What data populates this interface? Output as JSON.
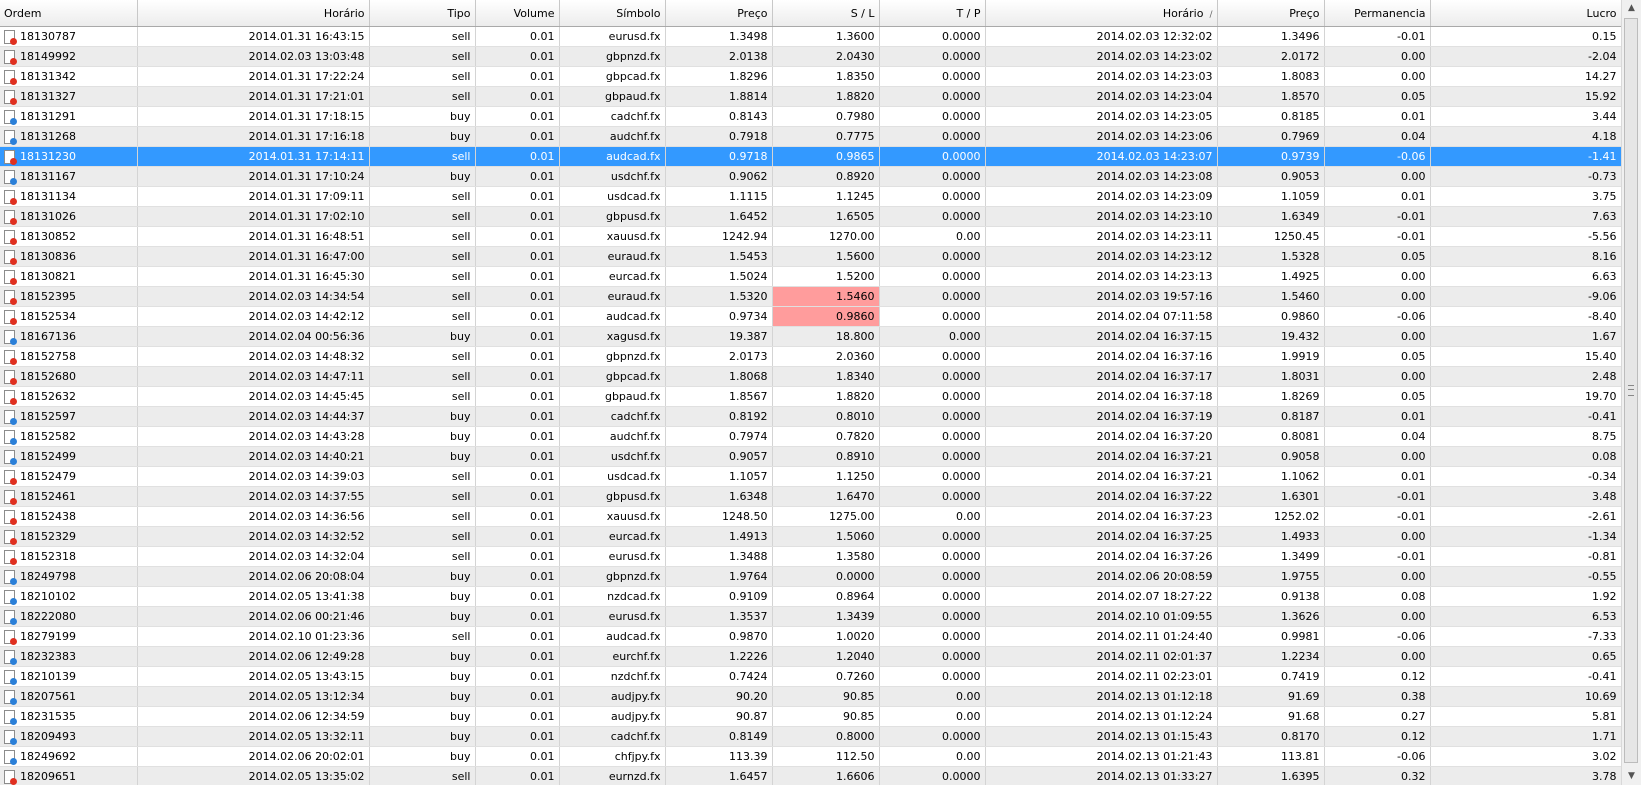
{
  "columns": [
    {
      "key": "ordem",
      "label": "Ordem"
    },
    {
      "key": "horario_open",
      "label": "Horário"
    },
    {
      "key": "tipo",
      "label": "Tipo"
    },
    {
      "key": "volume",
      "label": "Volume"
    },
    {
      "key": "simbolo",
      "label": "Símbolo"
    },
    {
      "key": "preco_open",
      "label": "Preço"
    },
    {
      "key": "sl",
      "label": "S / L"
    },
    {
      "key": "tp",
      "label": "T / P"
    },
    {
      "key": "horario_close",
      "label": "Horário",
      "sort_indicator": "/"
    },
    {
      "key": "preco_close",
      "label": "Preço"
    },
    {
      "key": "permanencia",
      "label": "Permanencia"
    },
    {
      "key": "lucro",
      "label": "Lucro"
    }
  ],
  "selected_row": 6,
  "highlighted_cells": [
    {
      "row": 13,
      "column": "sl"
    },
    {
      "row": 14,
      "column": "sl"
    }
  ],
  "colors": {
    "selection": "#3399ff",
    "highlight": "#ff9c9c",
    "sell_icon": "#e03020",
    "buy_icon": "#2a7fd8"
  },
  "rows": [
    [
      "18130787",
      "2014.01.31 16:43:15",
      "sell",
      "0.01",
      "eurusd.fx",
      "1.3498",
      "1.3600",
      "0.0000",
      "2014.02.03 12:32:02",
      "1.3496",
      "-0.01",
      "0.15"
    ],
    [
      "18149992",
      "2014.02.03 13:03:48",
      "sell",
      "0.01",
      "gbpnzd.fx",
      "2.0138",
      "2.0430",
      "0.0000",
      "2014.02.03 14:23:02",
      "2.0172",
      "0.00",
      "-2.04"
    ],
    [
      "18131342",
      "2014.01.31 17:22:24",
      "sell",
      "0.01",
      "gbpcad.fx",
      "1.8296",
      "1.8350",
      "0.0000",
      "2014.02.03 14:23:03",
      "1.8083",
      "0.00",
      "14.27"
    ],
    [
      "18131327",
      "2014.01.31 17:21:01",
      "sell",
      "0.01",
      "gbpaud.fx",
      "1.8814",
      "1.8820",
      "0.0000",
      "2014.02.03 14:23:04",
      "1.8570",
      "0.05",
      "15.92"
    ],
    [
      "18131291",
      "2014.01.31 17:18:15",
      "buy",
      "0.01",
      "cadchf.fx",
      "0.8143",
      "0.7980",
      "0.0000",
      "2014.02.03 14:23:05",
      "0.8185",
      "0.01",
      "3.44"
    ],
    [
      "18131268",
      "2014.01.31 17:16:18",
      "buy",
      "0.01",
      "audchf.fx",
      "0.7918",
      "0.7775",
      "0.0000",
      "2014.02.03 14:23:06",
      "0.7969",
      "0.04",
      "4.18"
    ],
    [
      "18131230",
      "2014.01.31 17:14:11",
      "sell",
      "0.01",
      "audcad.fx",
      "0.9718",
      "0.9865",
      "0.0000",
      "2014.02.03 14:23:07",
      "0.9739",
      "-0.06",
      "-1.41"
    ],
    [
      "18131167",
      "2014.01.31 17:10:24",
      "buy",
      "0.01",
      "usdchf.fx",
      "0.9062",
      "0.8920",
      "0.0000",
      "2014.02.03 14:23:08",
      "0.9053",
      "0.00",
      "-0.73"
    ],
    [
      "18131134",
      "2014.01.31 17:09:11",
      "sell",
      "0.01",
      "usdcad.fx",
      "1.1115",
      "1.1245",
      "0.0000",
      "2014.02.03 14:23:09",
      "1.1059",
      "0.01",
      "3.75"
    ],
    [
      "18131026",
      "2014.01.31 17:02:10",
      "sell",
      "0.01",
      "gbpusd.fx",
      "1.6452",
      "1.6505",
      "0.0000",
      "2014.02.03 14:23:10",
      "1.6349",
      "-0.01",
      "7.63"
    ],
    [
      "18130852",
      "2014.01.31 16:48:51",
      "sell",
      "0.01",
      "xauusd.fx",
      "1242.94",
      "1270.00",
      "0.00",
      "2014.02.03 14:23:11",
      "1250.45",
      "-0.01",
      "-5.56"
    ],
    [
      "18130836",
      "2014.01.31 16:47:00",
      "sell",
      "0.01",
      "euraud.fx",
      "1.5453",
      "1.5600",
      "0.0000",
      "2014.02.03 14:23:12",
      "1.5328",
      "0.05",
      "8.16"
    ],
    [
      "18130821",
      "2014.01.31 16:45:30",
      "sell",
      "0.01",
      "eurcad.fx",
      "1.5024",
      "1.5200",
      "0.0000",
      "2014.02.03 14:23:13",
      "1.4925",
      "0.00",
      "6.63"
    ],
    [
      "18152395",
      "2014.02.03 14:34:54",
      "sell",
      "0.01",
      "euraud.fx",
      "1.5320",
      "1.5460",
      "0.0000",
      "2014.02.03 19:57:16",
      "1.5460",
      "0.00",
      "-9.06"
    ],
    [
      "18152534",
      "2014.02.03 14:42:12",
      "sell",
      "0.01",
      "audcad.fx",
      "0.9734",
      "0.9860",
      "0.0000",
      "2014.02.04 07:11:58",
      "0.9860",
      "-0.06",
      "-8.40"
    ],
    [
      "18167136",
      "2014.02.04 00:56:36",
      "buy",
      "0.01",
      "xagusd.fx",
      "19.387",
      "18.800",
      "0.000",
      "2014.02.04 16:37:15",
      "19.432",
      "0.00",
      "1.67"
    ],
    [
      "18152758",
      "2014.02.03 14:48:32",
      "sell",
      "0.01",
      "gbpnzd.fx",
      "2.0173",
      "2.0360",
      "0.0000",
      "2014.02.04 16:37:16",
      "1.9919",
      "0.05",
      "15.40"
    ],
    [
      "18152680",
      "2014.02.03 14:47:11",
      "sell",
      "0.01",
      "gbpcad.fx",
      "1.8068",
      "1.8340",
      "0.0000",
      "2014.02.04 16:37:17",
      "1.8031",
      "0.00",
      "2.48"
    ],
    [
      "18152632",
      "2014.02.03 14:45:45",
      "sell",
      "0.01",
      "gbpaud.fx",
      "1.8567",
      "1.8820",
      "0.0000",
      "2014.02.04 16:37:18",
      "1.8269",
      "0.05",
      "19.70"
    ],
    [
      "18152597",
      "2014.02.03 14:44:37",
      "buy",
      "0.01",
      "cadchf.fx",
      "0.8192",
      "0.8010",
      "0.0000",
      "2014.02.04 16:37:19",
      "0.8187",
      "0.01",
      "-0.41"
    ],
    [
      "18152582",
      "2014.02.03 14:43:28",
      "buy",
      "0.01",
      "audchf.fx",
      "0.7974",
      "0.7820",
      "0.0000",
      "2014.02.04 16:37:20",
      "0.8081",
      "0.04",
      "8.75"
    ],
    [
      "18152499",
      "2014.02.03 14:40:21",
      "buy",
      "0.01",
      "usdchf.fx",
      "0.9057",
      "0.8910",
      "0.0000",
      "2014.02.04 16:37:21",
      "0.9058",
      "0.00",
      "0.08"
    ],
    [
      "18152479",
      "2014.02.03 14:39:03",
      "sell",
      "0.01",
      "usdcad.fx",
      "1.1057",
      "1.1250",
      "0.0000",
      "2014.02.04 16:37:21",
      "1.1062",
      "0.01",
      "-0.34"
    ],
    [
      "18152461",
      "2014.02.03 14:37:55",
      "sell",
      "0.01",
      "gbpusd.fx",
      "1.6348",
      "1.6470",
      "0.0000",
      "2014.02.04 16:37:22",
      "1.6301",
      "-0.01",
      "3.48"
    ],
    [
      "18152438",
      "2014.02.03 14:36:56",
      "sell",
      "0.01",
      "xauusd.fx",
      "1248.50",
      "1275.00",
      "0.00",
      "2014.02.04 16:37:23",
      "1252.02",
      "-0.01",
      "-2.61"
    ],
    [
      "18152329",
      "2014.02.03 14:32:52",
      "sell",
      "0.01",
      "eurcad.fx",
      "1.4913",
      "1.5060",
      "0.0000",
      "2014.02.04 16:37:25",
      "1.4933",
      "0.00",
      "-1.34"
    ],
    [
      "18152318",
      "2014.02.03 14:32:04",
      "sell",
      "0.01",
      "eurusd.fx",
      "1.3488",
      "1.3580",
      "0.0000",
      "2014.02.04 16:37:26",
      "1.3499",
      "-0.01",
      "-0.81"
    ],
    [
      "18249798",
      "2014.02.06 20:08:04",
      "buy",
      "0.01",
      "gbpnzd.fx",
      "1.9764",
      "0.0000",
      "0.0000",
      "2014.02.06 20:08:59",
      "1.9755",
      "0.00",
      "-0.55"
    ],
    [
      "18210102",
      "2014.02.05 13:41:38",
      "buy",
      "0.01",
      "nzdcad.fx",
      "0.9109",
      "0.8964",
      "0.0000",
      "2014.02.07 18:27:22",
      "0.9138",
      "0.08",
      "1.92"
    ],
    [
      "18222080",
      "2014.02.06 00:21:46",
      "buy",
      "0.01",
      "eurusd.fx",
      "1.3537",
      "1.3439",
      "0.0000",
      "2014.02.10 01:09:55",
      "1.3626",
      "0.00",
      "6.53"
    ],
    [
      "18279199",
      "2014.02.10 01:23:36",
      "sell",
      "0.01",
      "audcad.fx",
      "0.9870",
      "1.0020",
      "0.0000",
      "2014.02.11 01:24:40",
      "0.9981",
      "-0.06",
      "-7.33"
    ],
    [
      "18232383",
      "2014.02.06 12:49:28",
      "buy",
      "0.01",
      "eurchf.fx",
      "1.2226",
      "1.2040",
      "0.0000",
      "2014.02.11 02:01:37",
      "1.2234",
      "0.00",
      "0.65"
    ],
    [
      "18210139",
      "2014.02.05 13:43:15",
      "buy",
      "0.01",
      "nzdchf.fx",
      "0.7424",
      "0.7260",
      "0.0000",
      "2014.02.11 02:23:01",
      "0.7419",
      "0.12",
      "-0.41"
    ],
    [
      "18207561",
      "2014.02.05 13:12:34",
      "buy",
      "0.01",
      "audjpy.fx",
      "90.20",
      "90.85",
      "0.00",
      "2014.02.13 01:12:18",
      "91.69",
      "0.38",
      "10.69"
    ],
    [
      "18231535",
      "2014.02.06 12:34:59",
      "buy",
      "0.01",
      "audjpy.fx",
      "90.87",
      "90.85",
      "0.00",
      "2014.02.13 01:12:24",
      "91.68",
      "0.27",
      "5.81"
    ],
    [
      "18209493",
      "2014.02.05 13:32:11",
      "buy",
      "0.01",
      "cadchf.fx",
      "0.8149",
      "0.8000",
      "0.0000",
      "2014.02.13 01:15:43",
      "0.8170",
      "0.12",
      "1.71"
    ],
    [
      "18249692",
      "2014.02.06 20:02:01",
      "buy",
      "0.01",
      "chfjpy.fx",
      "113.39",
      "112.50",
      "0.00",
      "2014.02.13 01:21:43",
      "113.81",
      "-0.06",
      "3.02"
    ],
    [
      "18209651",
      "2014.02.05 13:35:02",
      "sell",
      "0.01",
      "eurnzd.fx",
      "1.6457",
      "1.6606",
      "0.0000",
      "2014.02.13 01:33:27",
      "1.6395",
      "0.32",
      "3.78"
    ]
  ],
  "scrollbar": {
    "up_icon": "arrow-up-icon",
    "down_icon": "arrow-down-icon"
  }
}
